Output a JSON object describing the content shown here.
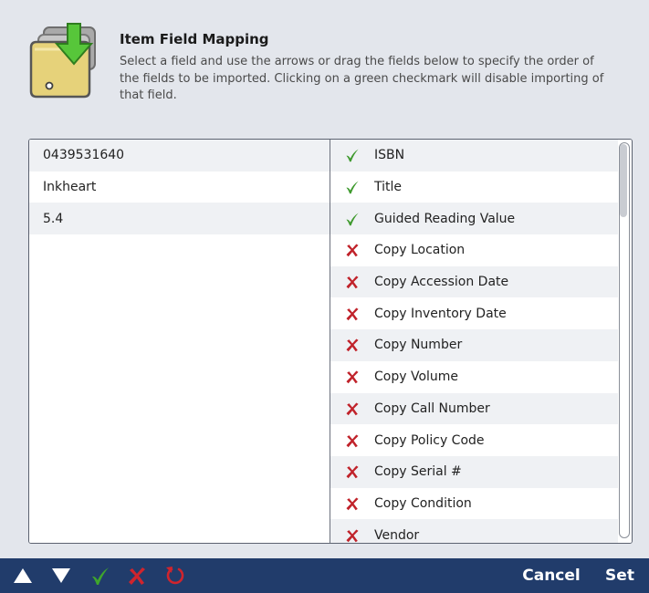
{
  "dialog": {
    "title": "Item Field Mapping",
    "description": "Select a field and use the arrows or drag the fields below to specify the order of the fields to be imported. Clicking on a green checkmark will disable importing of that field."
  },
  "source_values": [
    "0439531640",
    "Inkheart",
    "5.4"
  ],
  "fields": [
    {
      "label": "ISBN",
      "enabled": true
    },
    {
      "label": "Title",
      "enabled": true
    },
    {
      "label": "Guided Reading Value",
      "enabled": true
    },
    {
      "label": "Copy Location",
      "enabled": false
    },
    {
      "label": "Copy Accession Date",
      "enabled": false
    },
    {
      "label": "Copy Inventory Date",
      "enabled": false
    },
    {
      "label": "Copy Number",
      "enabled": false
    },
    {
      "label": "Copy Volume",
      "enabled": false
    },
    {
      "label": "Copy Call Number",
      "enabled": false
    },
    {
      "label": "Copy Policy Code",
      "enabled": false
    },
    {
      "label": "Copy Serial #",
      "enabled": false
    },
    {
      "label": "Copy Condition",
      "enabled": false
    },
    {
      "label": "Vendor",
      "enabled": false
    }
  ],
  "toolbar": {
    "move_up_icon": "arrow-up-icon",
    "move_down_icon": "arrow-down-icon",
    "enable_icon": "checkmark-icon",
    "disable_icon": "x-icon",
    "reset_icon": "reset-icon",
    "cancel_label": "Cancel",
    "set_label": "Set"
  },
  "colors": {
    "toolbar_bg": "#213c6b",
    "check_green": "#3f9a2e",
    "x_red": "#c0222a"
  }
}
